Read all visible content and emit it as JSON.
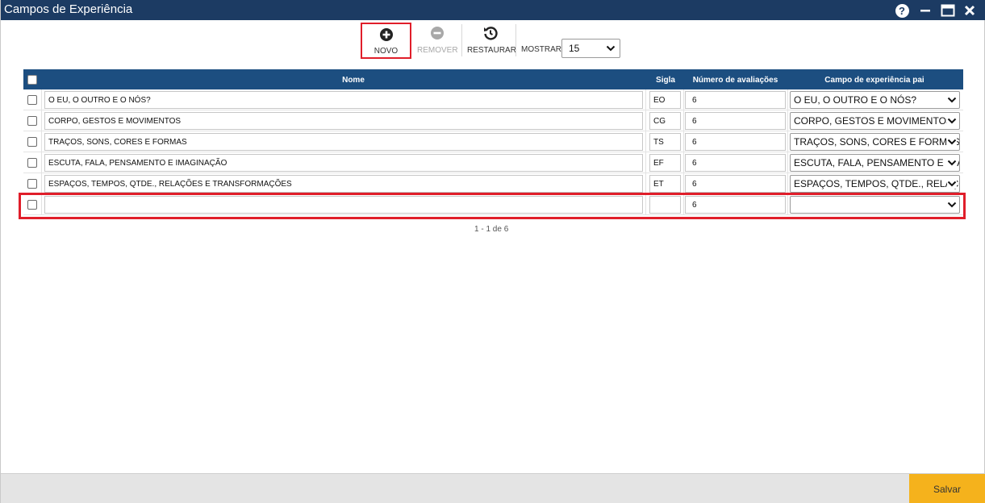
{
  "window": {
    "title": "Campos de Experiência"
  },
  "toolbar": {
    "novo_label": "NOVO",
    "remover_label": "REMOVER",
    "restaurar_label": "RESTAURAR",
    "mostrar_label": "MOSTRAR:",
    "mostrar_value": "15"
  },
  "grid": {
    "headers": {
      "nome": "Nome",
      "sigla": "Sigla",
      "numero": "Número de avaliações",
      "pai": "Campo de experiência pai"
    },
    "rows": [
      {
        "nome": "O EU, O OUTRO E O NÓS?",
        "sigla": "EO",
        "numero": "6",
        "pai": "O EU, O OUTRO E O NÓS?"
      },
      {
        "nome": "CORPO, GESTOS E MOVIMENTOS",
        "sigla": "CG",
        "numero": "6",
        "pai": "CORPO, GESTOS E MOVIMENTOS"
      },
      {
        "nome": "TRAÇOS, SONS, CORES E FORMAS",
        "sigla": "TS",
        "numero": "6",
        "pai": "TRAÇOS, SONS, CORES E FORMAS"
      },
      {
        "nome": "ESCUTA, FALA, PENSAMENTO E IMAGINAÇÃO",
        "sigla": "EF",
        "numero": "6",
        "pai": "ESCUTA, FALA, PENSAMENTO E IMAGI"
      },
      {
        "nome": "ESPAÇOS, TEMPOS, QTDE., RELAÇÕES E TRANSFORMAÇÕES",
        "sigla": "ET",
        "numero": "6",
        "pai": "ESPAÇOS, TEMPOS, QTDE., RELAÇÕES I"
      },
      {
        "nome": "",
        "sigla": "",
        "numero": "6",
        "pai": ""
      }
    ]
  },
  "pager": {
    "text": "1 - 1 de 6"
  },
  "footer": {
    "save_label": "Salvar"
  },
  "colors": {
    "titlebar": "#1c3b63",
    "header": "#1c4e80",
    "highlight": "#e01e2a",
    "save": "#f5b21c"
  }
}
